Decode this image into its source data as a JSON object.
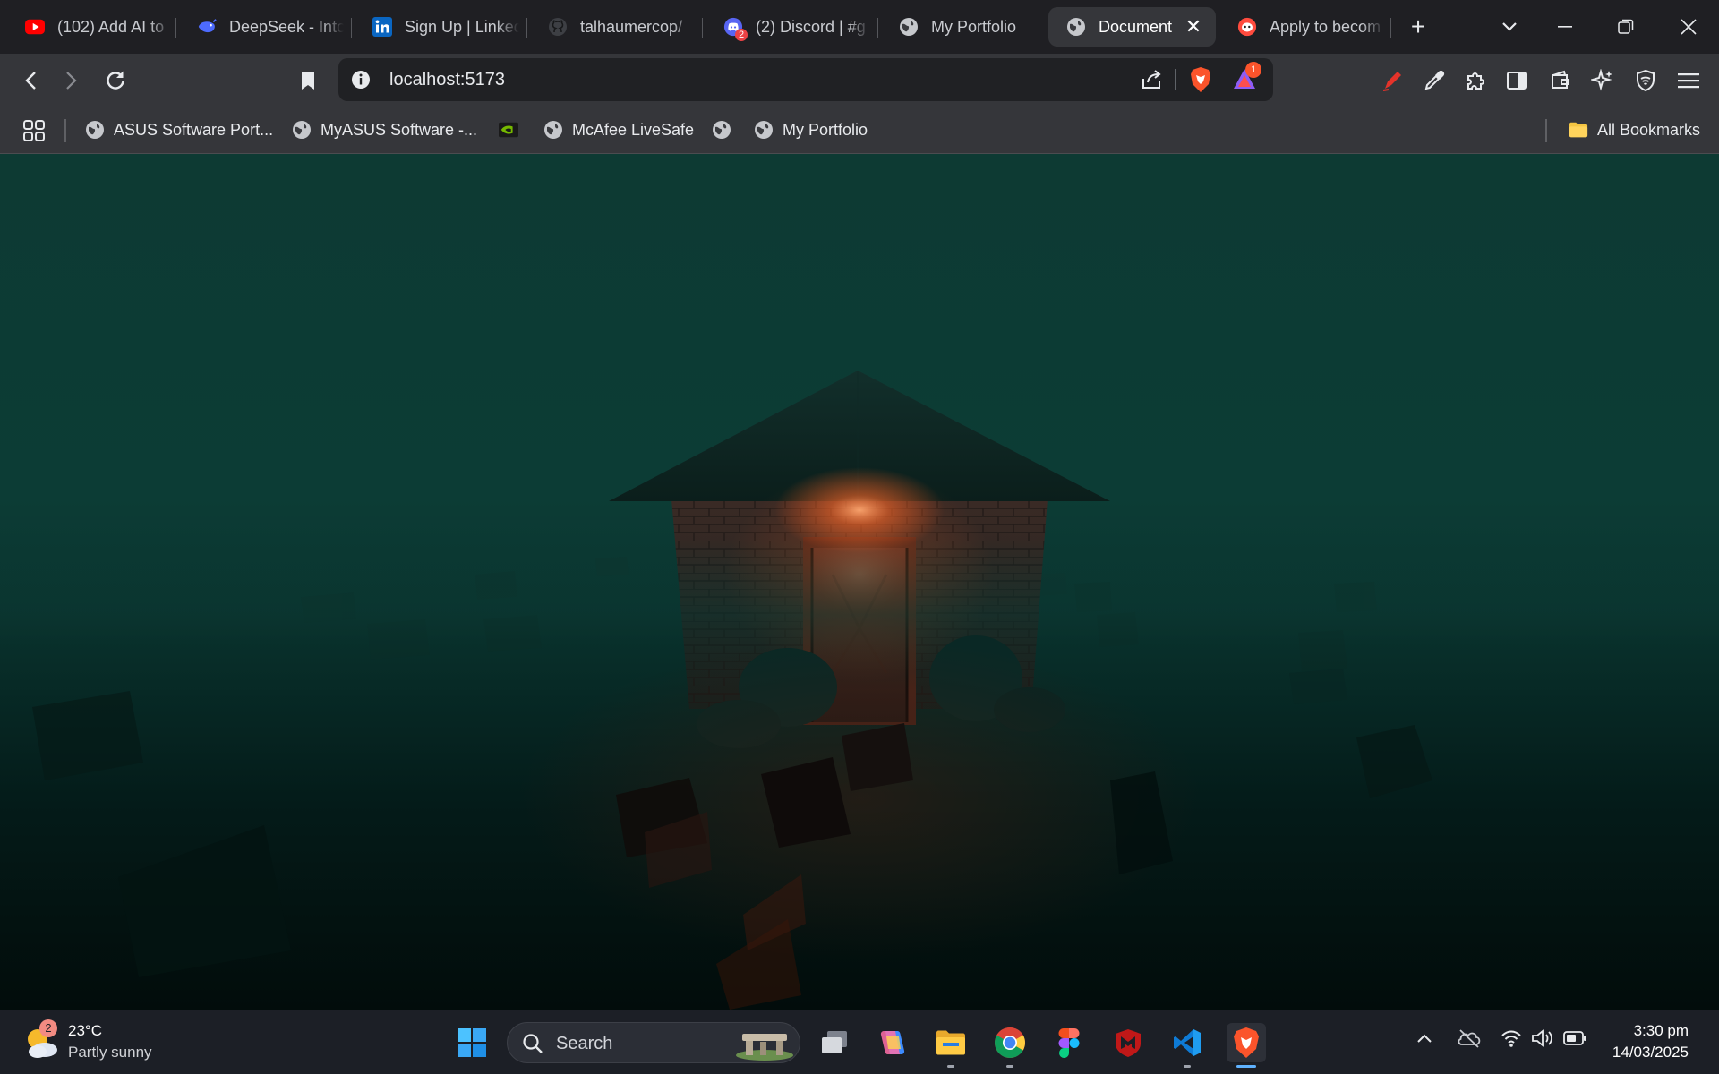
{
  "tabs": [
    {
      "title": "(102) Add AI to",
      "icon": "youtube-icon",
      "active": false
    },
    {
      "title": "DeepSeek - Into",
      "icon": "deepseek-icon",
      "active": false
    },
    {
      "title": "Sign Up | LinkedIn",
      "icon": "linkedin-icon",
      "active": false
    },
    {
      "title": "talhaumercop/",
      "icon": "github-icon",
      "active": false
    },
    {
      "title": "(2) Discord | #g",
      "icon": "discord-icon",
      "badge": "2",
      "active": false
    },
    {
      "title": "My Portfolio",
      "icon": "globe-icon",
      "active": false
    },
    {
      "title": "Document",
      "icon": "globe-icon",
      "active": true
    },
    {
      "title": "Apply to becom",
      "icon": "app-icon",
      "active": false
    }
  ],
  "tab_close_glyph": "✕",
  "new_tab_glyph": "+",
  "address_bar": {
    "url": "localhost:5173",
    "notification_badge": "1"
  },
  "bookmarks": {
    "items": [
      {
        "label": "ASUS Software Port...",
        "icon": "globe-icon"
      },
      {
        "label": "MyASUS Software -...",
        "icon": "globe-icon"
      },
      {
        "label": "",
        "icon": "nvidia-icon"
      },
      {
        "label": "McAfee LiveSafe",
        "icon": "globe-icon"
      },
      {
        "label": "",
        "icon": "globe-icon"
      },
      {
        "label": "My Portfolio",
        "icon": "globe-icon"
      }
    ],
    "all_bookmarks": "All Bookmarks"
  },
  "scene": {
    "sky_color": "#0d3a33",
    "ground_color": "#020c0b",
    "light_color": "#ff7a3c"
  },
  "taskbar": {
    "weather": {
      "temp": "23°C",
      "condition": "Partly sunny",
      "badge": "2"
    },
    "search_placeholder": "Search",
    "apps": [
      "windows-start-icon",
      "task-view-icon",
      "copilot-icon",
      "file-explorer-icon",
      "chrome-icon",
      "figma-icon",
      "mcafee-icon",
      "vscode-icon",
      "brave-icon"
    ],
    "clock": {
      "time": "3:30 pm",
      "date": "14/03/2025"
    }
  }
}
